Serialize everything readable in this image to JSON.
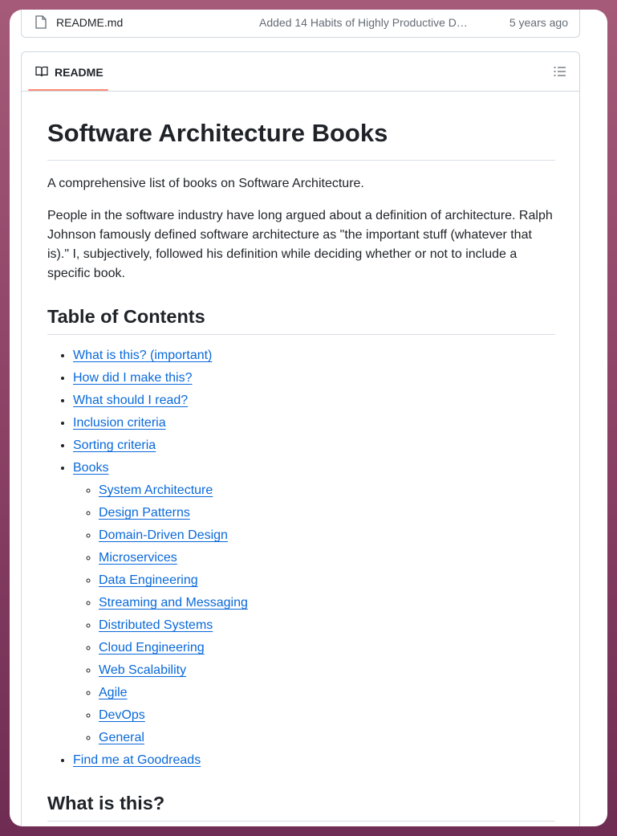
{
  "file_row": {
    "name": "README.md",
    "commit_message": "Added 14 Habits of Highly Productive D…",
    "age": "5 years ago"
  },
  "readme_header": {
    "tab_label": "README",
    "toc_button_icon": "list-unordered-icon"
  },
  "content": {
    "title": "Software Architecture Books",
    "intro": "A comprehensive list of books on Software Architecture.",
    "description": "People in the software industry have long argued about a definition of architecture. Ralph Johnson famously defined software architecture as \"the important stuff (whatever that is).\" I, subjectively, followed his definition while deciding whether or not to include a specific book.",
    "toc_heading": "Table of Contents",
    "toc": [
      "What is this? (important)",
      "How did I make this?",
      "What should I read?",
      "Inclusion criteria",
      "Sorting criteria",
      "Books"
    ],
    "books_sub": [
      "System Architecture",
      "Design Patterns",
      "Domain-Driven Design",
      "Microservices",
      "Data Engineering",
      "Streaming and Messaging",
      "Distributed Systems",
      "Cloud Engineering",
      "Web Scalability",
      "Agile",
      "DevOps",
      "General"
    ],
    "toc_last": "Find me at Goodreads",
    "section_heading": "What is this?"
  },
  "colors": {
    "link": "#0969da",
    "tab_underline": "#fd8c73",
    "border": "#d0d7de"
  }
}
